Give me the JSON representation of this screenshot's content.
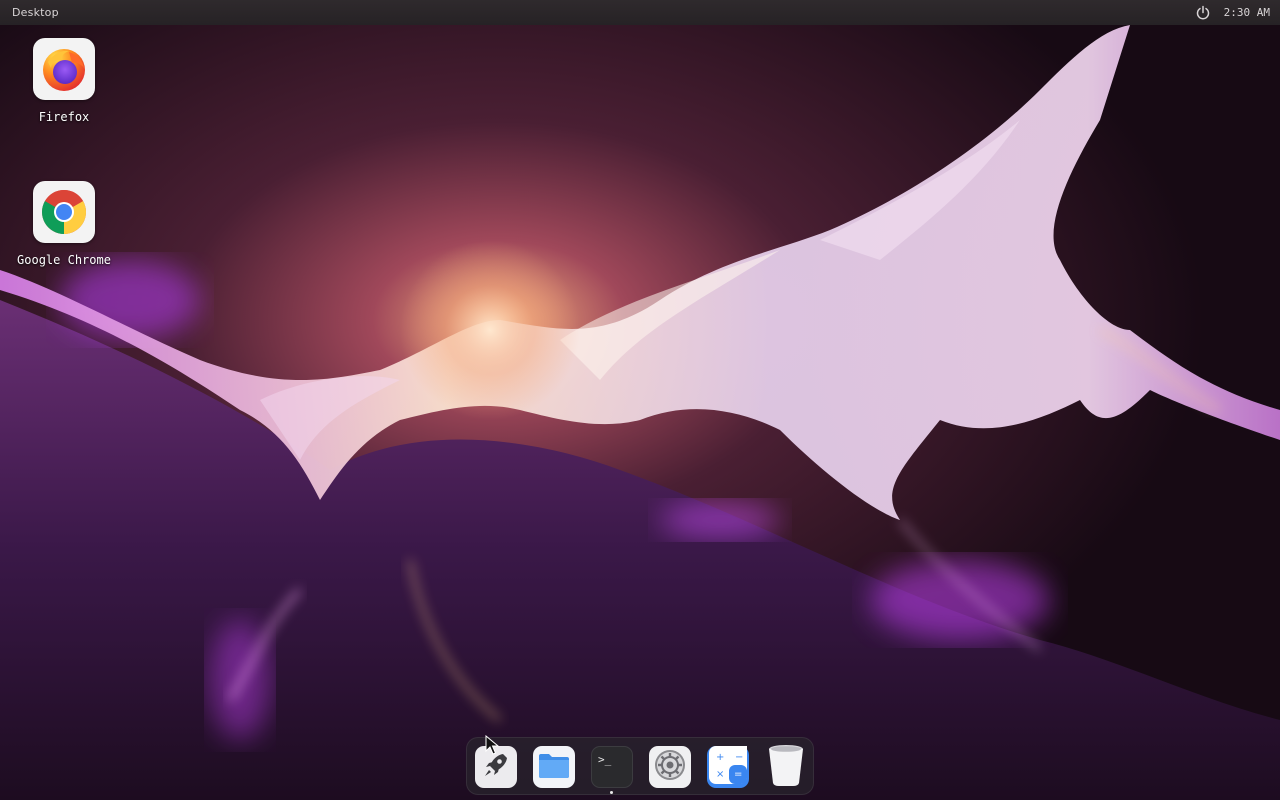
{
  "topbar": {
    "title": "Desktop",
    "power_icon": "power-icon",
    "clock": "2:30 AM"
  },
  "desktop_icons": [
    {
      "label": "Firefox",
      "icon": "firefox-icon"
    },
    {
      "label": "Google Chrome",
      "icon": "chrome-icon"
    }
  ],
  "dock": {
    "items": [
      {
        "name": "launcher",
        "icon": "rocket-icon"
      },
      {
        "name": "files",
        "icon": "folder-icon"
      },
      {
        "name": "terminal",
        "icon": "terminal-icon",
        "glyph": ">_",
        "running": true
      },
      {
        "name": "settings",
        "icon": "gear-icon"
      },
      {
        "name": "calculator",
        "icon": "calculator-icon"
      },
      {
        "name": "trash",
        "icon": "trash-icon"
      }
    ]
  },
  "colors": {
    "accent": "#b040e8",
    "wallpaper_glow": "#fbe3c8",
    "wallpaper_dark": "#1b0d18"
  }
}
